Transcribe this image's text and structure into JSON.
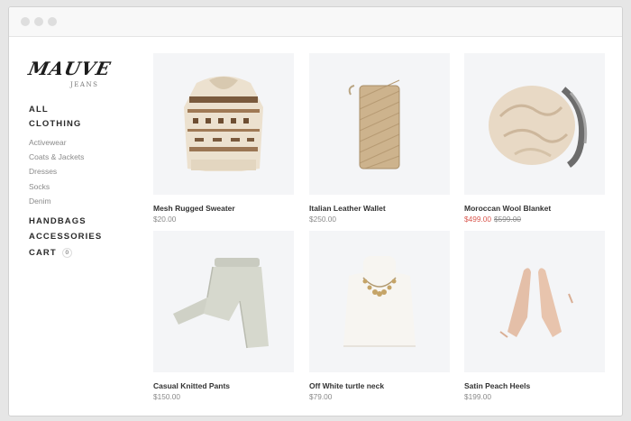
{
  "brand": {
    "logo_script": "MAUVE",
    "logo_sub": "JEANS"
  },
  "nav": {
    "all": "ALL",
    "clothing": "CLOTHING",
    "clothing_items": [
      "Activewear",
      "Coats & Jackets",
      "Dresses",
      "Socks",
      "Denim"
    ],
    "handbags": "HANDBAGS",
    "accessories": "ACCESSORIES",
    "cart": "CART",
    "cart_count": "0"
  },
  "products": [
    {
      "name": "Mesh Rugged Sweater",
      "price": "$20.00",
      "icon": "sweater-image"
    },
    {
      "name": "Italian Leather Wallet",
      "price": "$250.00",
      "icon": "wallet-image"
    },
    {
      "name": "Moroccan Wool Blanket",
      "sale_price": "$499.00",
      "old_price": "$599.00",
      "icon": "blanket-image"
    },
    {
      "name": "Casual Knitted Pants",
      "price": "$150.00",
      "icon": "pants-image"
    },
    {
      "name": "Off White turtle neck",
      "price": "$79.00",
      "icon": "turtleneck-image"
    },
    {
      "name": "Satin Peach Heels",
      "price": "$199.00",
      "icon": "heels-image"
    }
  ],
  "colors": {
    "sale": "#d9574e",
    "image_bg": "#f4f5f7"
  }
}
